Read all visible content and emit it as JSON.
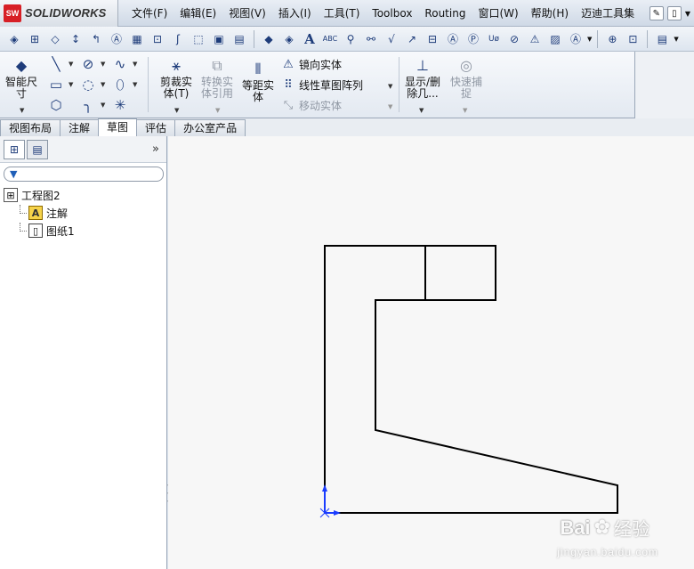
{
  "app": {
    "brand": "SOLIDWORKS",
    "logo_text": "SW"
  },
  "menubar": {
    "items": [
      "文件(F)",
      "编辑(E)",
      "视图(V)",
      "插入(I)",
      "工具(T)",
      "Toolbox",
      "Routing",
      "窗口(W)",
      "帮助(H)",
      "迈迪工具集"
    ]
  },
  "ribbon": {
    "smart_dimension": "智能尺寸",
    "trim_entities": "剪裁实体(T)",
    "convert_entities": "转换实体引用",
    "offset_entities": "等距实体",
    "mirror_entities": "镜向实体",
    "linear_pattern": "线性草图阵列",
    "move_entities": "移动实体",
    "display_delete_relations": "显示/删除几...",
    "quick_snaps": "快速捕捉"
  },
  "tabs": [
    "视图布局",
    "注解",
    "草图",
    "评估",
    "办公室产品"
  ],
  "active_tab": "草图",
  "panel": {
    "tree": [
      {
        "label": "工程图2",
        "icon": "drawing-icon"
      },
      {
        "label": "注解",
        "icon": "annotation-icon"
      },
      {
        "label": "图纸1",
        "icon": "sheet-icon"
      }
    ]
  },
  "watermark": {
    "logo": "Bai",
    "text": "经验",
    "url": "jingyan.baidu.com"
  },
  "colors": {
    "accent": "#1e3c7a",
    "sketch_line": "#000000",
    "origin": "#1a3cff"
  }
}
